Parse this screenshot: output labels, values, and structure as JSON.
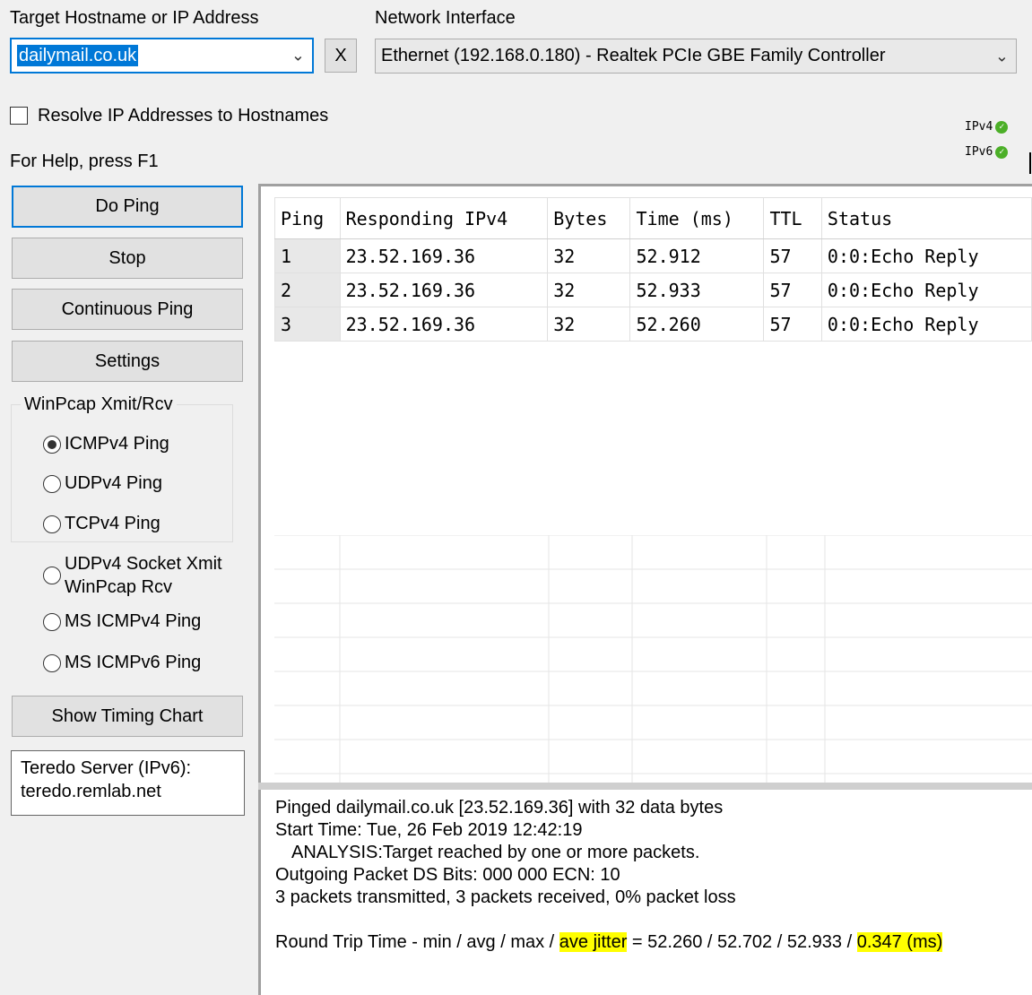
{
  "target": {
    "label": "Target Hostname or IP Address",
    "value": "dailymail.co.uk",
    "clear_label": "X"
  },
  "network": {
    "label": "Network Interface",
    "value": "Ethernet (192.168.0.180) - Realtek PCIe GBE Family Controller"
  },
  "resolve_label": "Resolve IP Addresses to Hostnames",
  "help_text": "For Help, press F1",
  "indicators": {
    "ipv4": "IPv4",
    "ipv6": "IPv6"
  },
  "buttons": {
    "do_ping": "Do Ping",
    "stop": "Stop",
    "continuous": "Continuous Ping",
    "settings": "Settings",
    "timing_chart": "Show Timing Chart"
  },
  "winpcap": {
    "title": "WinPcap Xmit/Rcv",
    "options": [
      "ICMPv4 Ping",
      "UDPv4 Ping",
      "TCPv4 Ping"
    ]
  },
  "other_options": {
    "socket_line1": "UDPv4 Socket Xmit",
    "socket_line2": "WinPcap Rcv",
    "ms_icmpv4": "MS ICMPv4 Ping",
    "ms_icmpv6": "MS ICMPv6 Ping"
  },
  "teredo": {
    "line1": "Teredo Server (IPv6):",
    "line2": "teredo.remlab.net"
  },
  "table": {
    "headers": [
      "Ping",
      "Responding IPv4",
      "Bytes",
      "Time (ms)",
      "TTL",
      "Status"
    ],
    "rows": [
      [
        "1",
        "23.52.169.36",
        "32",
        "52.912",
        "57",
        "0:0:Echo Reply"
      ],
      [
        "2",
        "23.52.169.36",
        "32",
        "52.933",
        "57",
        "0:0:Echo Reply"
      ],
      [
        "3",
        "23.52.169.36",
        "32",
        "52.260",
        "57",
        "0:0:Echo Reply"
      ]
    ]
  },
  "log": {
    "line1": "Pinged dailymail.co.uk [23.52.169.36] with 32 data bytes",
    "line2": "Start Time: Tue, 26 Feb 2019 12:42:19",
    "line3": "ANALYSIS:Target reached by one or more packets.",
    "line4": "Outgoing Packet DS Bits: 000 000 ECN: 10",
    "line5": "3 packets transmitted, 3 packets received, 0% packet loss",
    "rtt_prefix": "Round Trip Time - min / avg / max / ",
    "rtt_jitter_label": "ave jitter",
    "rtt_values": " = 52.260 / 52.702 / 52.933 / ",
    "rtt_jitter_value": "0.347 (ms)",
    "highlight_color": "#ffff00"
  },
  "colors": {
    "accent": "#0078d7",
    "ok": "#4caf28"
  }
}
